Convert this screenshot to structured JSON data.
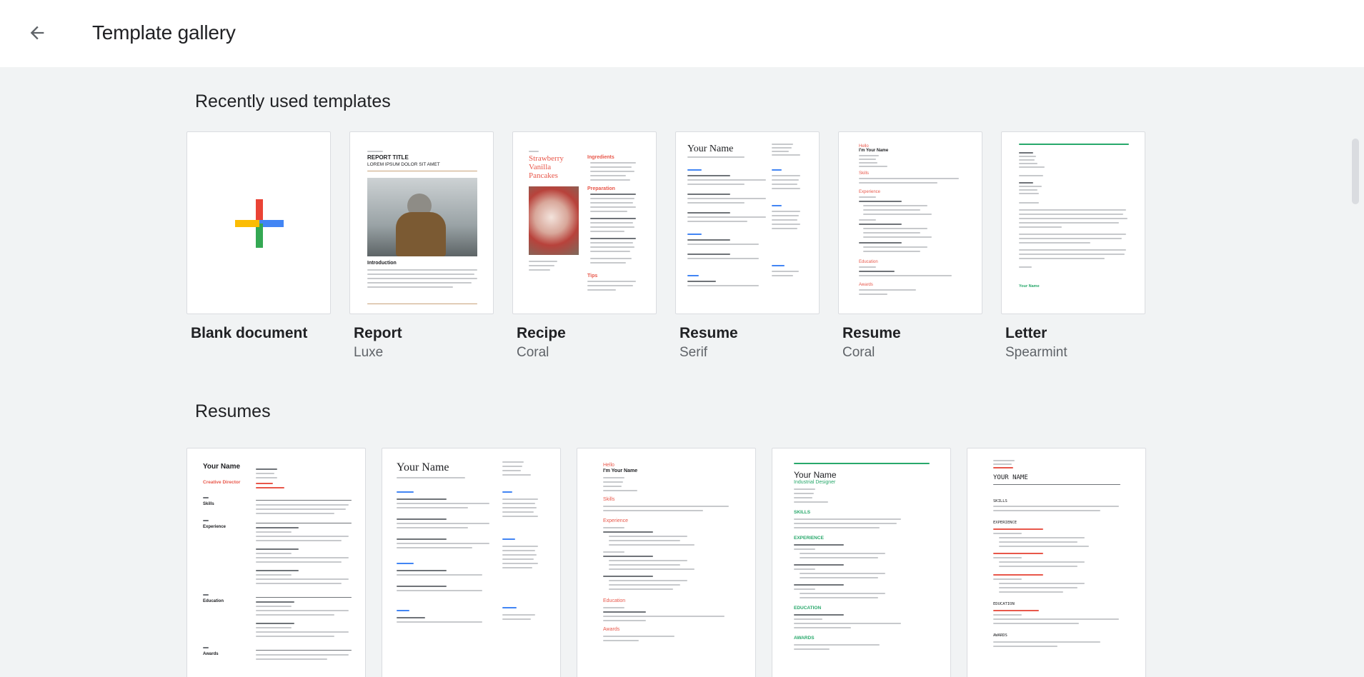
{
  "header": {
    "title": "Template gallery",
    "back_icon": "arrow-back-icon"
  },
  "sections": {
    "recent": {
      "title": "Recently used templates",
      "items": [
        {
          "name": "Blank document",
          "sub": ""
        },
        {
          "name": "Report",
          "sub": "Luxe"
        },
        {
          "name": "Recipe",
          "sub": "Coral"
        },
        {
          "name": "Resume",
          "sub": "Serif"
        },
        {
          "name": "Resume",
          "sub": "Coral"
        },
        {
          "name": "Letter",
          "sub": "Spearmint"
        }
      ]
    },
    "resumes": {
      "title": "Resumes"
    }
  },
  "thumbs": {
    "report": {
      "label": "REPORT TITLE",
      "sublabel": "LOREM IPSUM DOLOR SIT AMET",
      "heading": "Introduction"
    },
    "recipe": {
      "title": "Strawberry Vanilla Pancakes",
      "ingredients": "Ingredients",
      "preparation": "Preparation",
      "tips": "Tips"
    },
    "resume_serif": {
      "name": "Your Name"
    },
    "resume_coral": {
      "greeting": "Hello",
      "name": "I'm Your Name",
      "skills": "Skills",
      "experience": "Experience",
      "education": "Education",
      "awards": "Awards"
    },
    "letter": {
      "sign": "Your Name"
    },
    "resume_a": {
      "name": "Your Name",
      "role": "Creative Director",
      "skills": "Skills",
      "experience": "Experience",
      "education": "Education",
      "awards": "Awards"
    },
    "resume_b": {
      "name": "Your Name"
    },
    "resume_c": {
      "greeting": "Hello",
      "name": "I'm Your Name",
      "skills": "Skills",
      "experience": "Experience",
      "education": "Education",
      "awards": "Awards"
    },
    "resume_d": {
      "name": "Your Name",
      "role": "Industrial Designer",
      "skills": "SKILLS",
      "experience": "EXPERIENCE",
      "education": "EDUCATION",
      "awards": "AWARDS"
    },
    "resume_e": {
      "name": "YOUR NAME",
      "skills": "SKILLS",
      "experience": "EXPERIENCE",
      "education": "EDUCATION",
      "awards": "AWARDS"
    }
  },
  "colors": {
    "google_red": "#ea4335",
    "google_blue": "#4285f4",
    "google_yellow": "#fbbc04",
    "google_green": "#34a853",
    "coral": "#e8574a",
    "spearmint": "#28a86b",
    "title_text": "#202124",
    "sub_text": "#5f6368"
  }
}
